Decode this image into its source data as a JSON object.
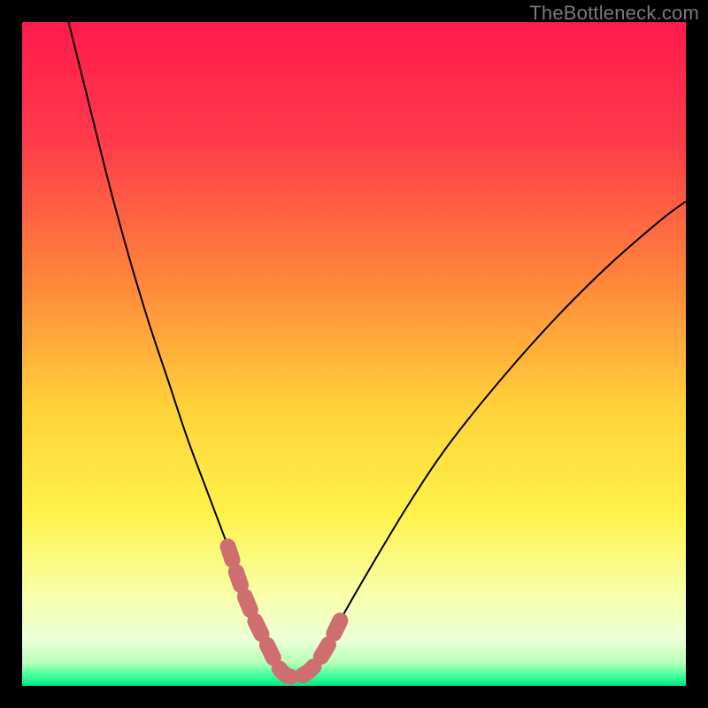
{
  "watermark": {
    "text": "TheBottleneck.com"
  },
  "chart_data": {
    "type": "line",
    "title": "",
    "xlabel": "",
    "ylabel": "",
    "xlim": [
      0,
      100
    ],
    "ylim": [
      0,
      100
    ],
    "gradient_stops": [
      {
        "offset": 0.0,
        "color": "#ff1a4d"
      },
      {
        "offset": 0.18,
        "color": "#ff3b4a"
      },
      {
        "offset": 0.4,
        "color": "#ff8a3a"
      },
      {
        "offset": 0.58,
        "color": "#ffd23a"
      },
      {
        "offset": 0.74,
        "color": "#fff24a"
      },
      {
        "offset": 0.86,
        "color": "#f8ffa8"
      },
      {
        "offset": 0.93,
        "color": "#ecffd8"
      },
      {
        "offset": 0.965,
        "color": "#b7ffb7"
      },
      {
        "offset": 0.985,
        "color": "#3fff9a"
      },
      {
        "offset": 1.0,
        "color": "#00e886"
      }
    ],
    "series": [
      {
        "name": "bottleneck-curve",
        "x": [
          7,
          10,
          13,
          16,
          19,
          22,
          25,
          28,
          31,
          33,
          35,
          37,
          38.5,
          40,
          42,
          44,
          46,
          48,
          52,
          58,
          64,
          72,
          80,
          88,
          96,
          100
        ],
        "y": [
          100,
          88,
          76,
          65,
          55,
          46,
          37,
          29,
          21,
          15,
          10,
          6,
          3,
          1.5,
          1.5,
          3,
          6,
          10,
          17,
          27,
          36,
          46,
          55,
          63,
          70,
          73
        ]
      }
    ],
    "highlight": {
      "name": "optimal-range",
      "color": "#cf6e6e",
      "x": [
        31,
        33,
        35,
        37,
        38.5,
        40,
        42,
        44,
        46,
        48
      ],
      "y": [
        21,
        15,
        10,
        6,
        3,
        1.5,
        1.5,
        3,
        6,
        10
      ]
    }
  }
}
